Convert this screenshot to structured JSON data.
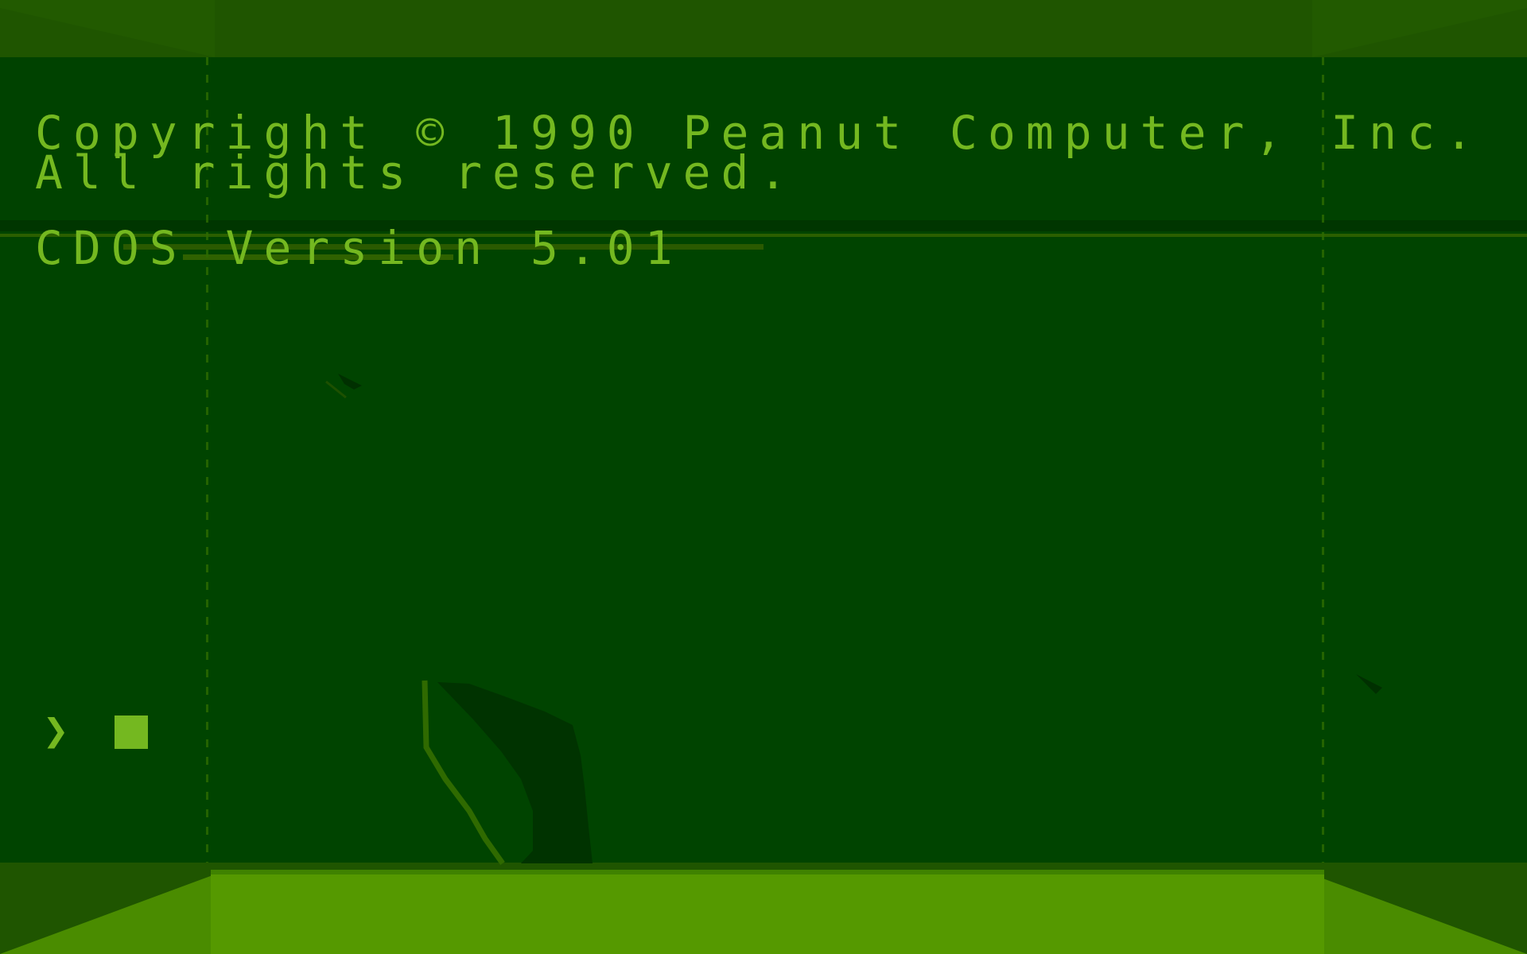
{
  "terminal": {
    "copyright_line": "Copyright © 1990 Peanut Computer, Inc.",
    "rights_line": "All rights reserved.",
    "version_line": "CDOS Version 5.01",
    "prompt": "❯"
  },
  "colors": {
    "background": "#004400",
    "text": "#74b820",
    "ceiling": "#1f5500",
    "floor": "#559900",
    "leaf_dark": "#003300",
    "leaf_outline": "#2f6a00"
  },
  "icons": {
    "cursor": "block-cursor",
    "leaf": "leaf-icon"
  }
}
